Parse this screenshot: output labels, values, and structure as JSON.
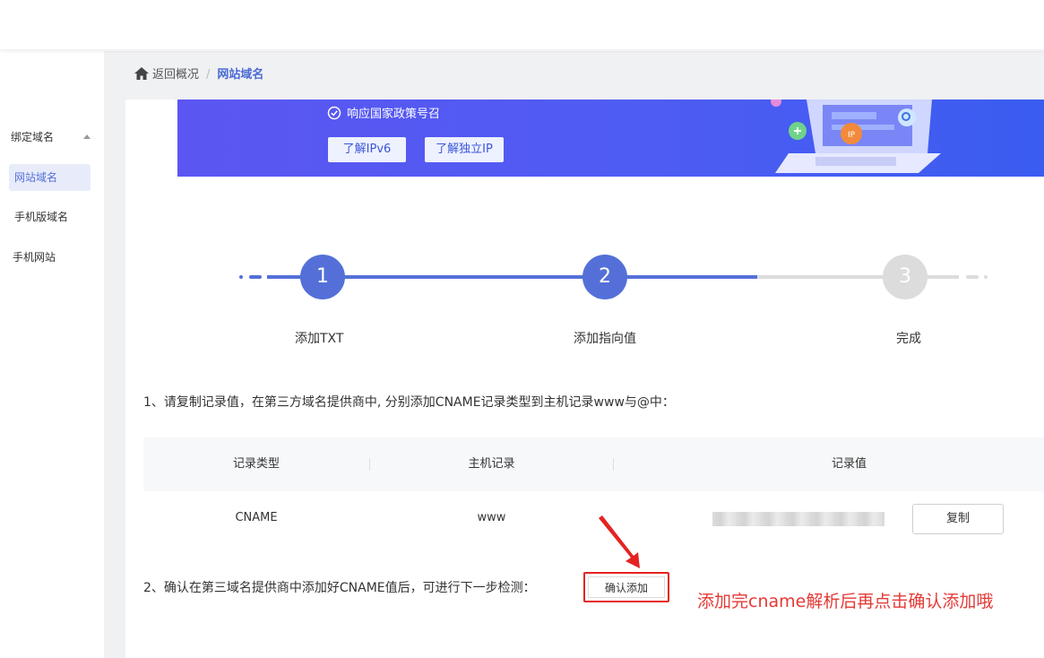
{
  "sidebar": {
    "group_label": "绑定域名",
    "items": [
      {
        "label": "网站域名",
        "active": true
      },
      {
        "label": "手机版域名",
        "active": false
      },
      {
        "label": "手机网站",
        "active": false
      }
    ]
  },
  "breadcrumb": {
    "back_label": "返回概况",
    "separator": "/",
    "current": "网站域名"
  },
  "banner": {
    "slogan": "响应国家政策号召",
    "buttons": [
      "了解IPv6",
      "了解独立IP"
    ],
    "illustration_badge": "IP"
  },
  "steps": [
    {
      "number": "1",
      "label": "添加TXT",
      "state": "done"
    },
    {
      "number": "2",
      "label": "添加指向值",
      "state": "current"
    },
    {
      "number": "3",
      "label": "完成",
      "state": "pending"
    }
  ],
  "instructions": {
    "step1": "1、请复制记录值，在第三方域名提供商中, 分别添加CNAME记录类型到主机记录www与@中：",
    "step2": "2、确认在第三域名提供商中添加好CNAME值后，可进行下一步检测："
  },
  "table": {
    "headers": [
      "记录类型",
      "主机记录",
      "记录值"
    ],
    "rows": [
      {
        "type": "CNAME",
        "host": "www",
        "value": ""
      }
    ],
    "copy_label": "复制"
  },
  "confirm_label": "确认添加",
  "annotation": "添加完cname解析后再点击确认添加哦",
  "colors": {
    "primary": "#5470d8",
    "banner": "#5b56f2",
    "annotation_red": "#e53935",
    "step_pending": "#dcdcdc"
  }
}
